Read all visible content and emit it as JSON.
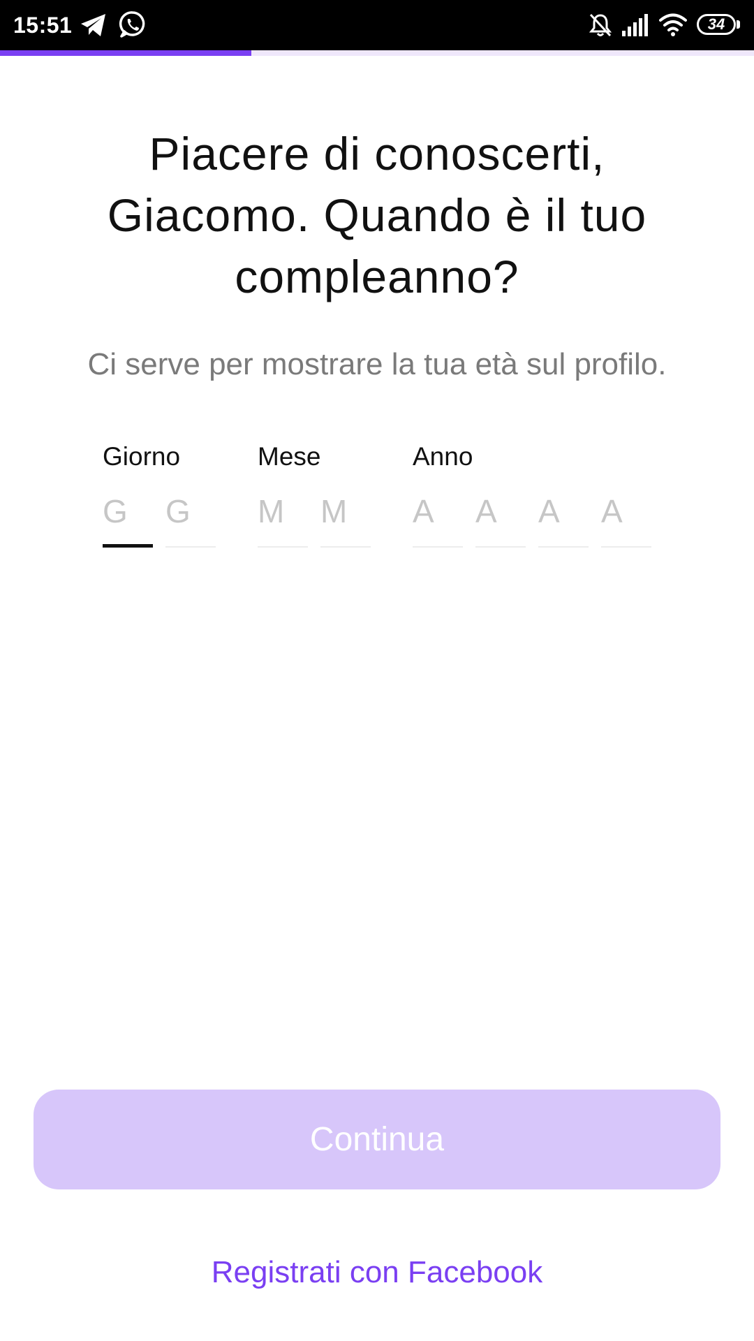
{
  "status_bar": {
    "time": "15:51",
    "battery": "34",
    "icons": [
      "telegram-icon",
      "whatsapp-icon",
      "bell-off-icon",
      "signal-icon",
      "wifi-icon",
      "battery-icon"
    ]
  },
  "progress": {
    "fraction": 0.333,
    "color": "#7a3ff2",
    "track_color": "#efe7fb"
  },
  "headline": "Piacere di conoscerti, Giacomo. Quando è il tuo compleanno?",
  "subtitle": "Ci serve per mostrare la tua età sul profilo.",
  "date_fields": {
    "day": {
      "label": "Giorno",
      "placeholders": [
        "G",
        "G"
      ]
    },
    "month": {
      "label": "Mese",
      "placeholders": [
        "M",
        "M"
      ]
    },
    "year": {
      "label": "Anno",
      "placeholders": [
        "A",
        "A",
        "A",
        "A"
      ]
    },
    "active_field": "day-digit-1"
  },
  "continue_button": {
    "label": "Continua",
    "enabled": false,
    "color": "#d7c6fa"
  },
  "facebook_link": {
    "label": "Registrati con Facebook",
    "color": "#7a3ff2"
  }
}
